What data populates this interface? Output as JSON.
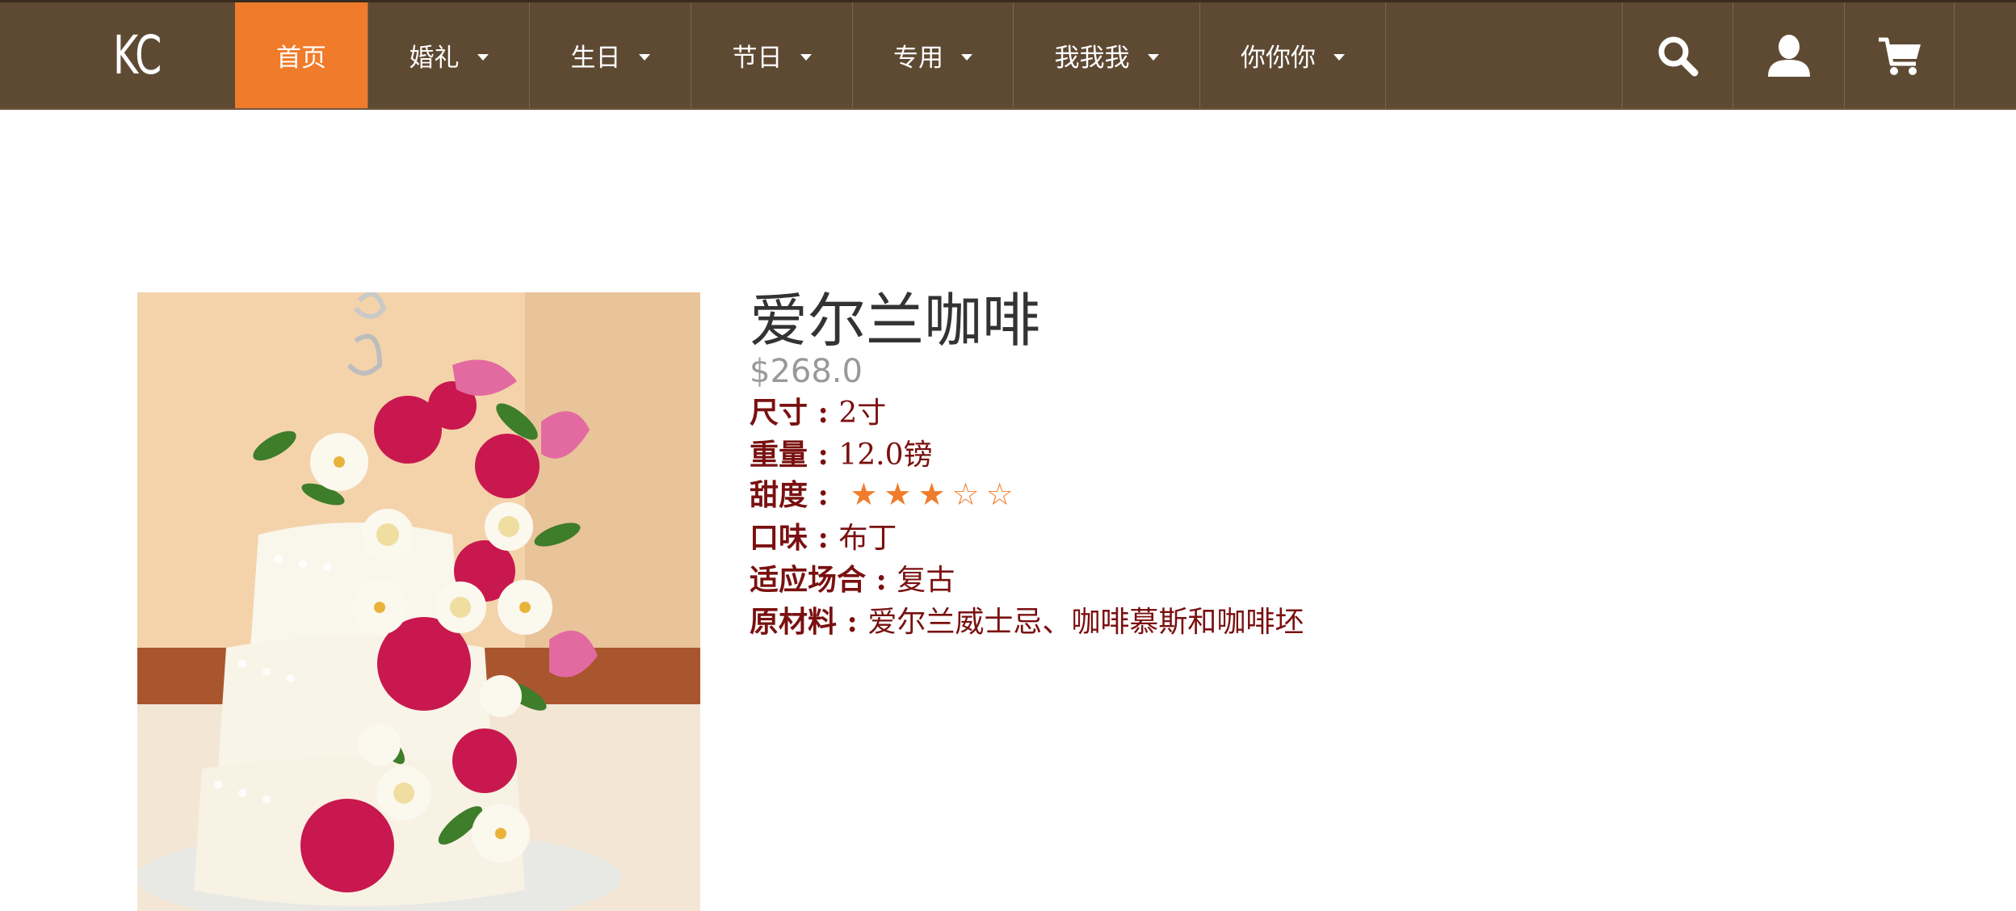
{
  "nav": {
    "logo": "KC",
    "items": [
      {
        "label": "首页"
      },
      {
        "label": "婚礼"
      },
      {
        "label": "生日"
      },
      {
        "label": "节日"
      },
      {
        "label": "专用"
      },
      {
        "label": "我我我"
      },
      {
        "label": "你你你"
      }
    ],
    "icons": [
      "search-icon",
      "user-icon",
      "cart-icon"
    ],
    "colors": {
      "bar": "#5e4a33",
      "active": "#f07c2b"
    }
  },
  "product": {
    "title": "爱尔兰咖啡",
    "price": "$268.0",
    "size": {
      "label": "尺寸 : ",
      "value": "2寸"
    },
    "weight": {
      "label": "重量 : ",
      "value": "12.0镑"
    },
    "sweetness": {
      "label": "甜度 : ",
      "stars": "★★★☆☆",
      "rating": 3,
      "max": 5
    },
    "flavor": {
      "label": "口味 : ",
      "value": "布丁"
    },
    "occasion": {
      "label": "适应场合 : ",
      "value": "复古"
    },
    "ingredients": {
      "label": "原材料 : ",
      "value": "爱尔兰威士忌、咖啡慕斯和咖啡坯"
    },
    "image": "three-tier white cake with pink roses and white orchids"
  }
}
